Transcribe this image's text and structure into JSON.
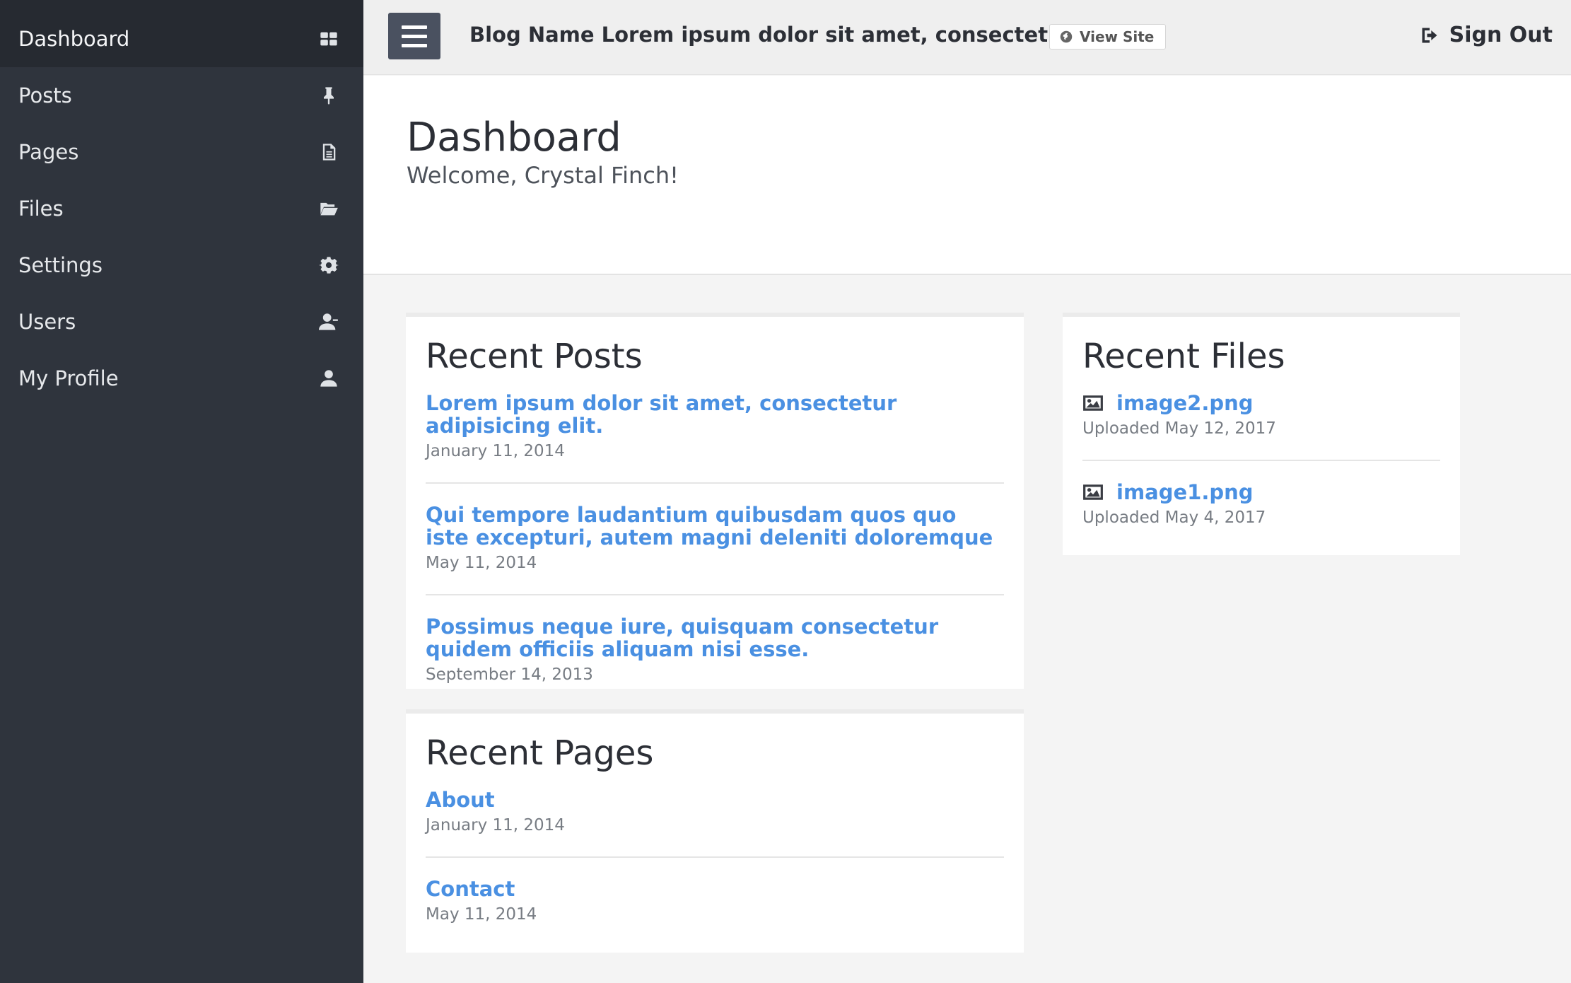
{
  "sidebar": {
    "items": [
      {
        "label": "Dashboard",
        "icon": "dashboard-grid-icon",
        "active": true
      },
      {
        "label": "Posts",
        "icon": "pin-icon"
      },
      {
        "label": "Pages",
        "icon": "document-icon"
      },
      {
        "label": "Files",
        "icon": "folder-open-icon"
      },
      {
        "label": "Settings",
        "icon": "gear-icon"
      },
      {
        "label": "Users",
        "icon": "users-icon"
      },
      {
        "label": "My Profile",
        "icon": "user-icon"
      }
    ]
  },
  "topbar": {
    "blog_name": "Blog Name Lorem ipsum dolor sit amet, consectetur adipi...",
    "view_site": "View Site",
    "sign_out": "Sign Out"
  },
  "header": {
    "title": "Dashboard",
    "welcome": "Welcome, Crystal Finch!"
  },
  "recent_posts": {
    "title": "Recent Posts",
    "items": [
      {
        "title": "Lorem ipsum dolor sit amet, consectetur adipisicing elit.",
        "date": "January 11, 2014"
      },
      {
        "title": "Qui tempore laudantium quibusdam quos quo iste excepturi, autem magni deleniti doloremque",
        "date": "May 11, 2014"
      },
      {
        "title": "Possimus neque iure, quisquam consectetur quidem officiis aliquam nisi esse.",
        "date": "September 14, 2013"
      }
    ]
  },
  "recent_pages": {
    "title": "Recent Pages",
    "items": [
      {
        "title": "About",
        "date": "January 11, 2014"
      },
      {
        "title": "Contact",
        "date": "May 11, 2014"
      }
    ]
  },
  "recent_files": {
    "title": "Recent Files",
    "items": [
      {
        "name": "image2.png",
        "meta": "Uploaded May 12, 2017"
      },
      {
        "name": "image1.png",
        "meta": "Uploaded May 4, 2017"
      }
    ]
  },
  "colors": {
    "sidebar_bg": "#2f343d",
    "sidebar_active": "#262a31",
    "link": "#4a90e2",
    "menu_button": "#4a5160"
  }
}
